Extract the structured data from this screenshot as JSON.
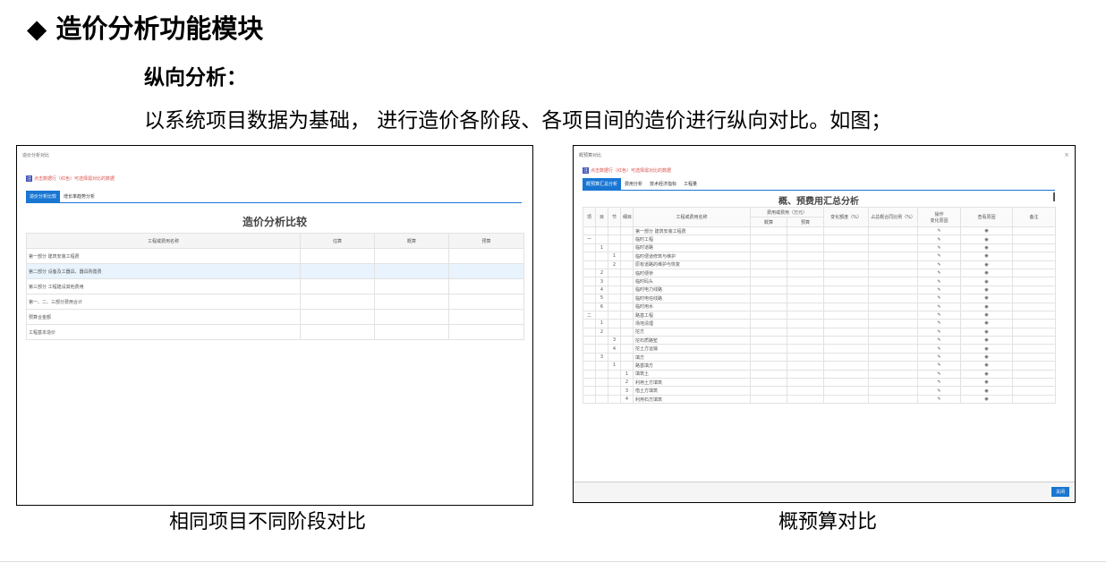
{
  "heading": {
    "bullet": "◆",
    "title": "造价分析功能模块"
  },
  "subheading": "纵向分析：",
  "description": "以系统项目数据为基础， 进行造价各阶段、各项目间的造价进行纵向对比。如图；",
  "captions": {
    "left": "相同项目不同阶段对比",
    "right": "概预算对比"
  },
  "screen1": {
    "window_title": "造价分析对比",
    "hint_tag": "注",
    "hint": "点击数据行（红色）可选择需对比的数据",
    "tabs": [
      "造价分析比较",
      "增长率趋势分析"
    ],
    "active_tab": 0,
    "panel_title": "造价分析比较",
    "columns": [
      "工程或费用名称",
      "估算",
      "概算",
      "预算"
    ],
    "rows": [
      "第一部分 建筑安装工程费",
      "第二部分 设备及工器具、器具购置费",
      "第三部分 工程建设其他费用",
      "第一、二、三部分费用合计",
      "预算合金额",
      "工程基本造价"
    ],
    "highlight_row": 1
  },
  "screen2": {
    "window_title": "概预算对比",
    "close_symbol": "×",
    "hint_tag": "注",
    "hint": "点击数据行（红色）可选择需对比的数据",
    "tabs": [
      "概预算汇总分析",
      "费用分析",
      "技术经济指标",
      "工程量"
    ],
    "active_tab": 0,
    "panel_title": "概、预费用汇总分析",
    "headers": {
      "c1": "项",
      "c2": "目",
      "c3": "节",
      "c4": "细目",
      "name": "工程或费用名称",
      "amount_group": "费用或费用（万元）",
      "amount_a": "概算",
      "amount_b": "预算",
      "diff": "变化额度（%）",
      "ratio": "占总概合同比例（%）",
      "op": "操作",
      "op2": "变化原因",
      "view": "查看原因",
      "remark": "备注"
    },
    "rows": [
      [
        "",
        "",
        "",
        "",
        "第一部分 建筑安装工程费"
      ],
      [
        "一",
        "",
        "",
        "",
        "临时工程"
      ],
      [
        "",
        "1",
        "",
        "",
        "临时道路"
      ],
      [
        "",
        "",
        "1",
        "",
        "临时便道修筑与维护"
      ],
      [
        "",
        "",
        "2",
        "",
        "原有道路的维护与恢复"
      ],
      [
        "",
        "2",
        "",
        "",
        "临时便桥"
      ],
      [
        "",
        "3",
        "",
        "",
        "临时码头"
      ],
      [
        "",
        "4",
        "",
        "",
        "临时电力线路"
      ],
      [
        "",
        "5",
        "",
        "",
        "临时电信线路"
      ],
      [
        "",
        "6",
        "",
        "",
        "临时用水"
      ],
      [
        "二",
        "",
        "",
        "",
        "路基工程"
      ],
      [
        "",
        "1",
        "",
        "",
        "场地清理"
      ],
      [
        "",
        "2",
        "",
        "",
        "挖方"
      ],
      [
        "",
        "",
        "3",
        "",
        "挖石质路堑"
      ],
      [
        "",
        "",
        "4",
        "",
        "挖土方运输"
      ],
      [
        "",
        "3",
        "",
        "",
        "填方"
      ],
      [
        "",
        "",
        "1",
        "",
        "路基填方"
      ],
      [
        "",
        "",
        "",
        "1",
        "填筑土"
      ],
      [
        "",
        "",
        "",
        "2",
        "利用土方填筑"
      ],
      [
        "",
        "",
        "",
        "3",
        "借土方填筑"
      ],
      [
        "",
        "",
        "",
        "4",
        "利用石方填筑"
      ]
    ],
    "row_edit_icon": "✎",
    "row_view_icon": "◉",
    "close_button": "关闭"
  }
}
